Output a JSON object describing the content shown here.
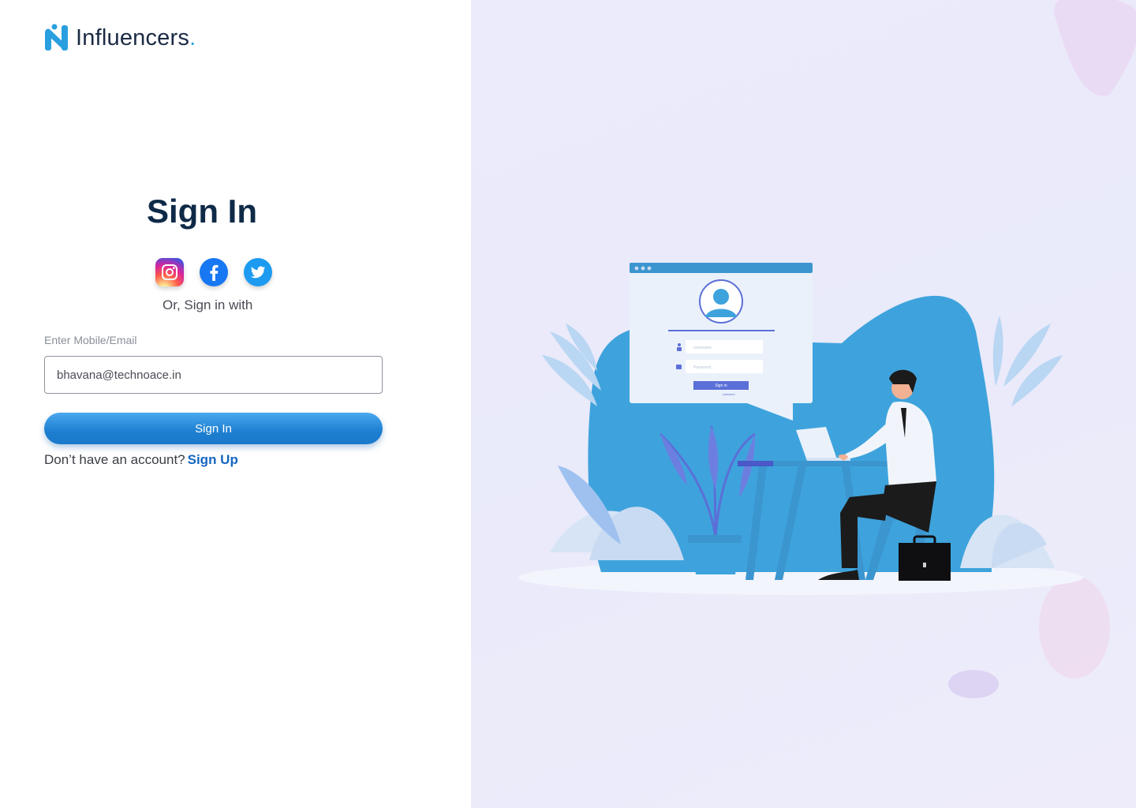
{
  "brand": {
    "name": "Influencers",
    "dot": ".",
    "color": "#27a3e0"
  },
  "signin": {
    "title": "Sign In",
    "social": [
      {
        "name": "instagram",
        "icon": "instagram-icon"
      },
      {
        "name": "facebook",
        "icon": "facebook-icon"
      },
      {
        "name": "twitter",
        "icon": "twitter-icon"
      }
    ],
    "or_text": "Or, Sign in with",
    "field_label": "Enter Mobile/Email",
    "field_value": "bhavana@technoace.in",
    "button_label": "Sign In",
    "no_account_text": "Don’t have an account?",
    "signup_link": "Sign Up"
  },
  "illustration": {
    "mock_username": "Username",
    "mock_password": "Password...",
    "mock_button": "Sign in",
    "mock_link": "password"
  },
  "colors": {
    "accent": "#1b78cb",
    "title": "#0e2a47",
    "illustration_blue": "#3ea3dc"
  }
}
